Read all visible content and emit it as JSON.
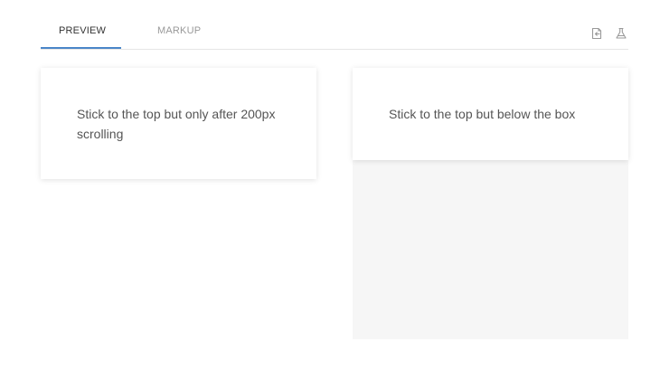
{
  "tabs": {
    "preview_label": "PREVIEW",
    "markup_label": "MARKUP",
    "active": "PREVIEW",
    "accent_color": "#4a86c8"
  },
  "toolbar": {
    "icons": [
      "export-icon",
      "flask-icon"
    ]
  },
  "examples": {
    "left_text": "Stick to the top but only after 200px scrolling",
    "right_text": "Stick to the top but below the box"
  },
  "colors": {
    "scroll_area_bg": "#f6f6f6",
    "text": "#555555"
  }
}
